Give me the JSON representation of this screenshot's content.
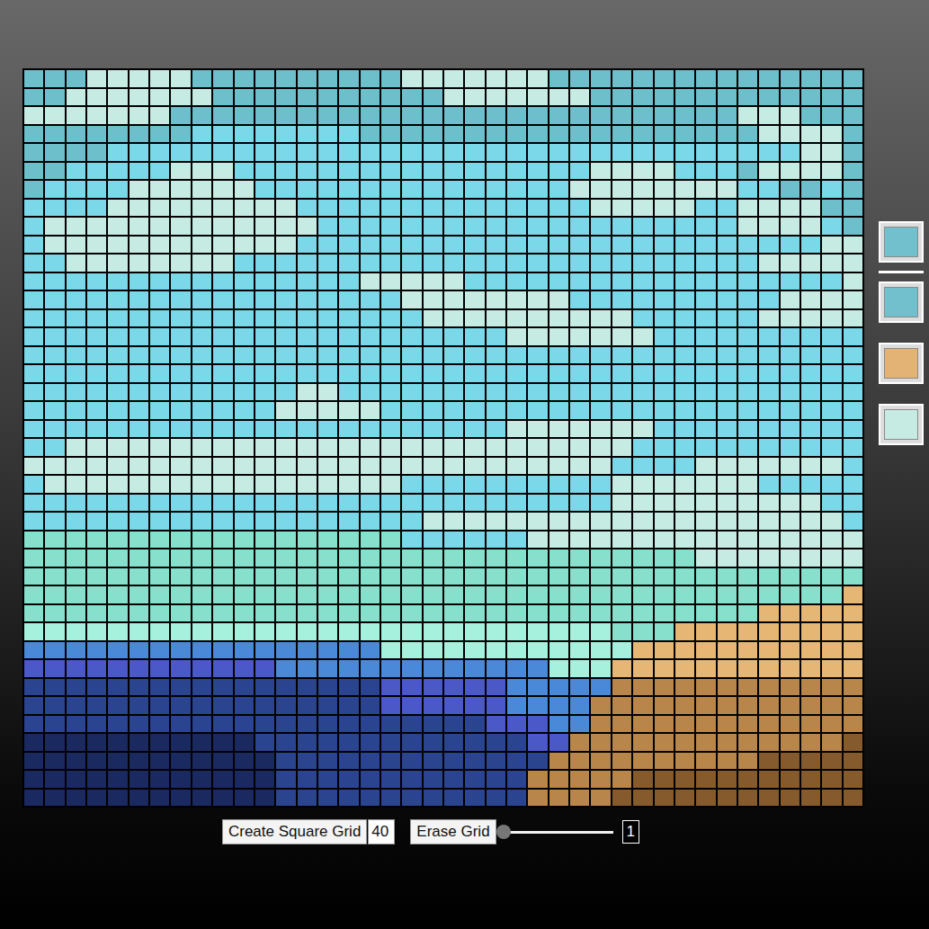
{
  "grid": {
    "palette": {
      "A": "#6dbfcc",
      "B": "#7ad8e8",
      "C": "#c6ebe3",
      "D": "#86e0cc",
      "E": "#a6f0de",
      "F": "#4a88d8",
      "G": "#4a58c8",
      "H": "#2a4490",
      "I": "#1a2a60",
      "J": "#e6b675",
      "K": "#b8864a",
      "L": "#855a2c"
    },
    "rows": [
      "AAACCCCCAAAAAAAAAACCCCCCCAAAAAAAAAAAAAAA",
      "AACCCCCCCAAAAAAAAAAACCCCCCCAAAAAAAAAAAAA",
      "CCCCCCCAAAAAAAAAAAAAAAAAAAAAAAAAAACCCAAA",
      "AAAAAAAABBBBBBBBAAAAAAAAAAAAAAAAAAACCCCA",
      "AAAABBBBBBBBBBBBBBBBBBBBBBBBBBBBBBBBBCCA",
      "AABBBBBCCCBBBBBBBBBBBBBBBBBCCCCBBBACCCCA",
      "ABBBBCCCCCCBBBBBBBBBBBBBBBCCCCCCCCBBAABA",
      "BBBBCCCCCCCCCBBBBBBBBBBBBBBCCCCCBBCCCCAA",
      "BCCCCCCCCCCCCCBBBBBBBBBBBBBBBBBBBBCCCCBA",
      "BCCCCCCCCCCCCBBBBBBBBBBBBBBBBBBBBBBBBBCC",
      "BBCCCCCCCCBBBBBBBBBBBBBBBBBBBBBBBBBCCCCC",
      "BBBBBBBBBBBBBBBBCCCCCBBBBBBBBBBBBBBBBBBC",
      "BBBBBBBBBBBBBBBBBBCCCCCCCCBBBBBBBBBBCCCC",
      "BBBBBBBBBBBBBBBBBBBCCCCCCCCCCBBBBBBCCCCC",
      "BBBBBBBBBBBBBBBBBBBBBBBCCCCCCCBBBBBBBBBB",
      "BBBBBBBBBBBBBBBBBBBBBBBBBBBBBBBBBBBBBBBB",
      "BBBBBBBBBBBBBBBBBBBBBBBBBBBBBBBBBBBBBBBB",
      "BBBBBBBBBBBBBCCBBBBBBBBBBBBBBBBBBBBBBBBB",
      "BBBBBBBBBBBBCCCCCBBBBBBBBBBBBBBBBBBBBBBB",
      "BBBBBBBBBBBBBBBBBBBBBBBCCCCCCCBBBBBBBBBB",
      "BBCCCCCCCCCCCCCCCCCCCCCCCCCCCBBBBBBBBBBB",
      "CCCCCCCCCCCCCCCCCCCCCCCCCCCCBBBBCCCCCCCB",
      "BCCCCCCCCCCCCCCCCCBBBBBBBBBBCCCCCCCBBBBB",
      "BBBBBBBBBBBBBBBBBBBBBBBBBBBBCCCCCCCCCCBB",
      "BBBBBBBBBBBBBBBBBBBCCCCCCCCCCCCCCCCCCCCB",
      "DDDDDDDDDDDDDDDDDDBBBBBBCCCCCCCCCCCCCCCC",
      "DDDDDDDDDDDDDDDDDDDDDDDDDDDDDDDDCCCCCCCC",
      "DDDDDDDDDDDDDDDDDDDDDDDDDDDDDDDDDDDDDDDD",
      "DDDDDDDDDDDDDDDDDDDDDDDDDDDDDDDDDDDDDDDJ",
      "DDDDDDDDDDDDDDDDDDDDDDDDDDDDDDDDDDDJJJJJ",
      "EEEEEEEEEEEEEEEEEEEEEEEEEEEEDDDJJJJJJJJJ",
      "FFFFFFFFFFFFFFFFFEEEEEEEEEEEEJJJJJJJJJJJ",
      "GGGGGGGGGGGGFFFFFFFFFFFFFEEEJJJJJJJJJJJJ",
      "HHHHHHHHHHHHHHHHHGGGGGGFFFFFKKKKKKKKKKKK",
      "HHHHHHHHHHHHHHHHHGGGGGGFFFFKKKKKKKKKKKKK",
      "HHHHHHHHHHHHHHHHHHHHHHGGGFFKKKKKKKKKKKKK",
      "IIIIIIIIIIIHHHHHHHHHHHHHGGKKKKKKKKKKKKKL",
      "IIIIIIIIIIIIHHHHHHHHHHHHHKKKKKKKKKKLLLLL",
      "IIIIIIIIIIIIHHHHHHHHHHHHKKKKKLLLLLLLLLLL",
      "IIIIIIIIIIIIHHHHHHHHHHHHKKKKLLLLLLLLLLLL"
    ]
  },
  "controls": {
    "create_button": "Create Square Grid",
    "size_value": "40",
    "erase_button": "Erase Grid",
    "slider": {
      "level": 0,
      "reading": "1"
    }
  },
  "current_color": {
    "color": "#72c0cd"
  },
  "saved_colors": [
    {
      "color": "#72c0cd"
    },
    {
      "color": "#e3b375"
    },
    {
      "color": "#c6ebe3"
    }
  ]
}
